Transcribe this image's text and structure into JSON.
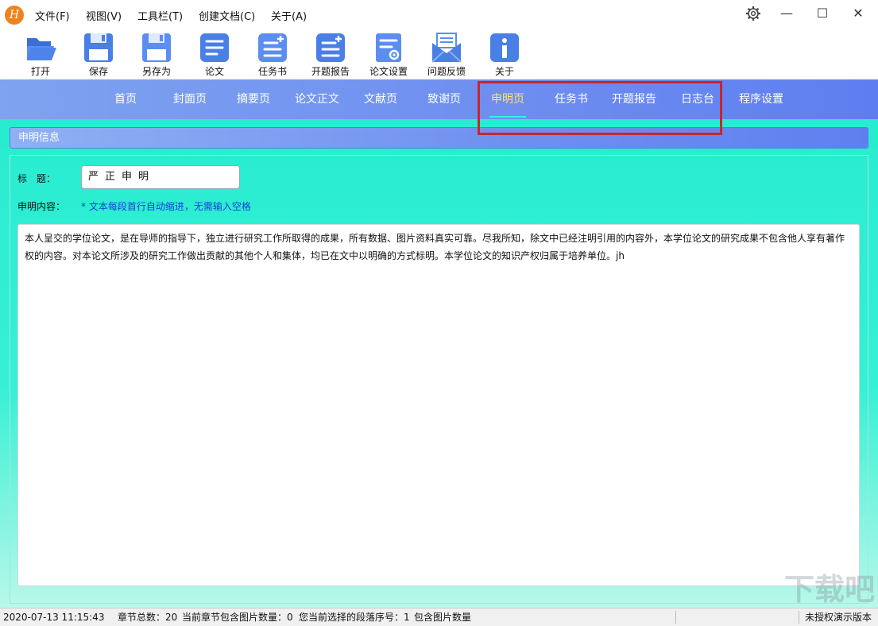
{
  "app": {
    "logo_text": "H",
    "accent": "#f0821e"
  },
  "menu": [
    "文件(F)",
    "视图(V)",
    "工具栏(T)",
    "创建文档(C)",
    "关于(A)"
  ],
  "window_controls": {
    "settings": "⚙",
    "minimize": "—",
    "maximize": "☐",
    "close": "✕"
  },
  "toolbar": [
    {
      "label": "打开",
      "icon": "folder-open-icon"
    },
    {
      "label": "保存",
      "icon": "save-icon"
    },
    {
      "label": "另存为",
      "icon": "save-as-icon"
    },
    {
      "label": "论文",
      "icon": "document-icon"
    },
    {
      "label": "任务书",
      "icon": "task-book-icon"
    },
    {
      "label": "开题报告",
      "icon": "proposal-report-icon"
    },
    {
      "label": "论文设置",
      "icon": "document-settings-icon"
    },
    {
      "label": "问题反馈",
      "icon": "feedback-mail-icon"
    },
    {
      "label": "关于",
      "icon": "info-icon"
    }
  ],
  "nav": {
    "items": [
      "首页",
      "封面页",
      "摘要页",
      "论文正文",
      "文献页",
      "致谢页",
      "申明页",
      "任务书",
      "开题报告",
      "日志台",
      "程序设置"
    ],
    "active": "申明页",
    "active_color": "#ffe66a",
    "highlight_color": "#c8262c"
  },
  "section": {
    "title": "申明信息"
  },
  "form": {
    "title_label": "标　题：",
    "title_value": "严正申明",
    "content_label": "申明内容：",
    "hint": "* 文本每段首行自动缩进，无需输入空格",
    "content": "本人呈交的学位论文，是在导师的指导下，独立进行研究工作所取得的成果，所有数据、图片资料真实可靠。尽我所知，除文中已经注明引用的内容外，本学位论文的研究成果不包含他人享有著作权的内容。对本论文所涉及的研究工作做出贡献的其他个人和集体，均已在文中以明确的方式标明。本学位论文的知识产权归属于培养单位。jh"
  },
  "status": {
    "datetime": "2020-07-13 11:15:43",
    "chapters": "章节总数：20",
    "chapter_images": "当前章节包含图片数量：0",
    "paragraph": "您当前选择的段落序号：1",
    "paragraph_images": "包含图片数量",
    "license": "未授权演示版本"
  },
  "watermark": "下载吧"
}
